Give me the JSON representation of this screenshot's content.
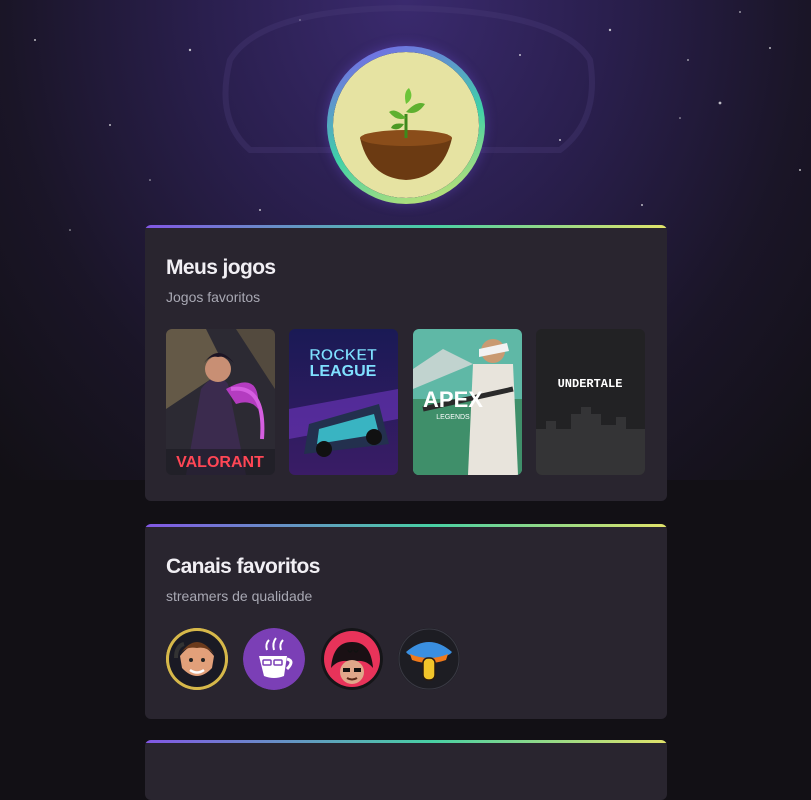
{
  "profile": {
    "avatar_icon": "sprout-pot-icon"
  },
  "games_card": {
    "title": "Meus jogos",
    "subtitle": "Jogos favoritos",
    "games": [
      {
        "label": "VALORANT",
        "icon": "valorant-cover"
      },
      {
        "label": "ROCKET LEAGUE",
        "line1": "ROCKET",
        "line2": "LEAGUE",
        "icon": "rocket-league-cover"
      },
      {
        "label": "APEX LEGENDS",
        "line1": "APEX",
        "line2": "LEGENDS",
        "icon": "apex-legends-cover"
      },
      {
        "label": "UNDERTALE",
        "icon": "undertale-cover"
      }
    ]
  },
  "channels_card": {
    "title": "Canais favoritos",
    "subtitle": "streamers de qualidade",
    "channels": [
      {
        "icon": "streamer-avatar-1"
      },
      {
        "icon": "coffee-mug-avatar"
      },
      {
        "icon": "streamer-avatar-3"
      },
      {
        "icon": "mushroom-avatar"
      }
    ]
  },
  "colors": {
    "gradient_start": "#8257e5",
    "gradient_mid": "#48d0a4",
    "gradient_end": "#e1e36a",
    "card_bg": "#29252f",
    "page_bg": "#121015"
  }
}
